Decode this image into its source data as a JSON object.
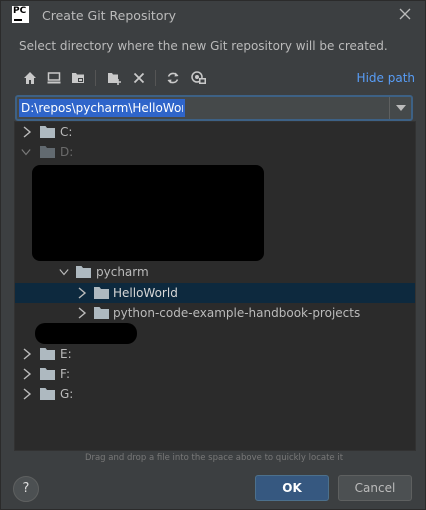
{
  "dialog": {
    "title": "Create Git Repository",
    "description": "Select directory where the new Git repository will be created.",
    "app_logo_text": "PC"
  },
  "toolbar": {
    "icons": [
      "home-icon",
      "desktop-icon",
      "project-folder-icon",
      "new-folder-icon",
      "delete-icon",
      "refresh-icon",
      "show-hidden-icon"
    ],
    "hide_path_label": "Hide path"
  },
  "path": {
    "value": "D:\\repos\\pycharm\\HelloWorld"
  },
  "tree": {
    "drives": {
      "c": "C:",
      "d": "D:",
      "e": "E:",
      "f": "F:",
      "g": "G:"
    },
    "pycharm": "pycharm",
    "children": {
      "helloworld": "HelloWorld",
      "handbook": "python-code-example-handbook-projects"
    }
  },
  "hint": "Drag and drop a file into the space above to quickly locate it",
  "buttons": {
    "help": "?",
    "ok": "OK",
    "cancel": "Cancel"
  },
  "colors": {
    "background": "#3c3f41",
    "tree_background": "#2b2b2b",
    "selection": "#0d293e",
    "accent_link": "#589df6",
    "ok_button": "#365880",
    "folder": "#aeb9c0"
  }
}
